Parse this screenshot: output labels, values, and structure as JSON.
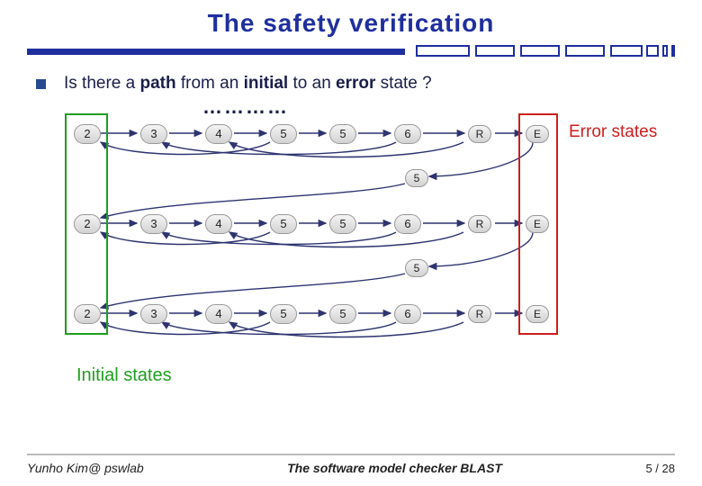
{
  "title": "The safety verification",
  "question": {
    "prefix": "Is there a ",
    "w1": "path",
    "mid1": " from an ",
    "w2": "initial",
    "mid2": " to an ",
    "w3": "error",
    "suffix": " state ?"
  },
  "dots": "…………",
  "rows": [
    {
      "nodes": [
        "2",
        "3",
        "4",
        "5",
        "5",
        "6",
        "R",
        "E"
      ]
    },
    {
      "nodes": [
        "2",
        "3",
        "4",
        "5",
        "5",
        "6",
        "R",
        "E"
      ]
    },
    {
      "nodes": [
        "2",
        "3",
        "4",
        "5",
        "5",
        "6",
        "R",
        "E"
      ]
    }
  ],
  "bridge_label": "5",
  "labels": {
    "error": "Error states",
    "initial": "Initial states"
  },
  "footer": {
    "left": "Yunho Kim@ pswlab",
    "center": "The software model checker BLAST",
    "page_cur": "5",
    "page_total": "28"
  },
  "colors": {
    "accent": "#1f2f9e",
    "initial": "#1e9e1e",
    "error": "#cc1e1e"
  }
}
